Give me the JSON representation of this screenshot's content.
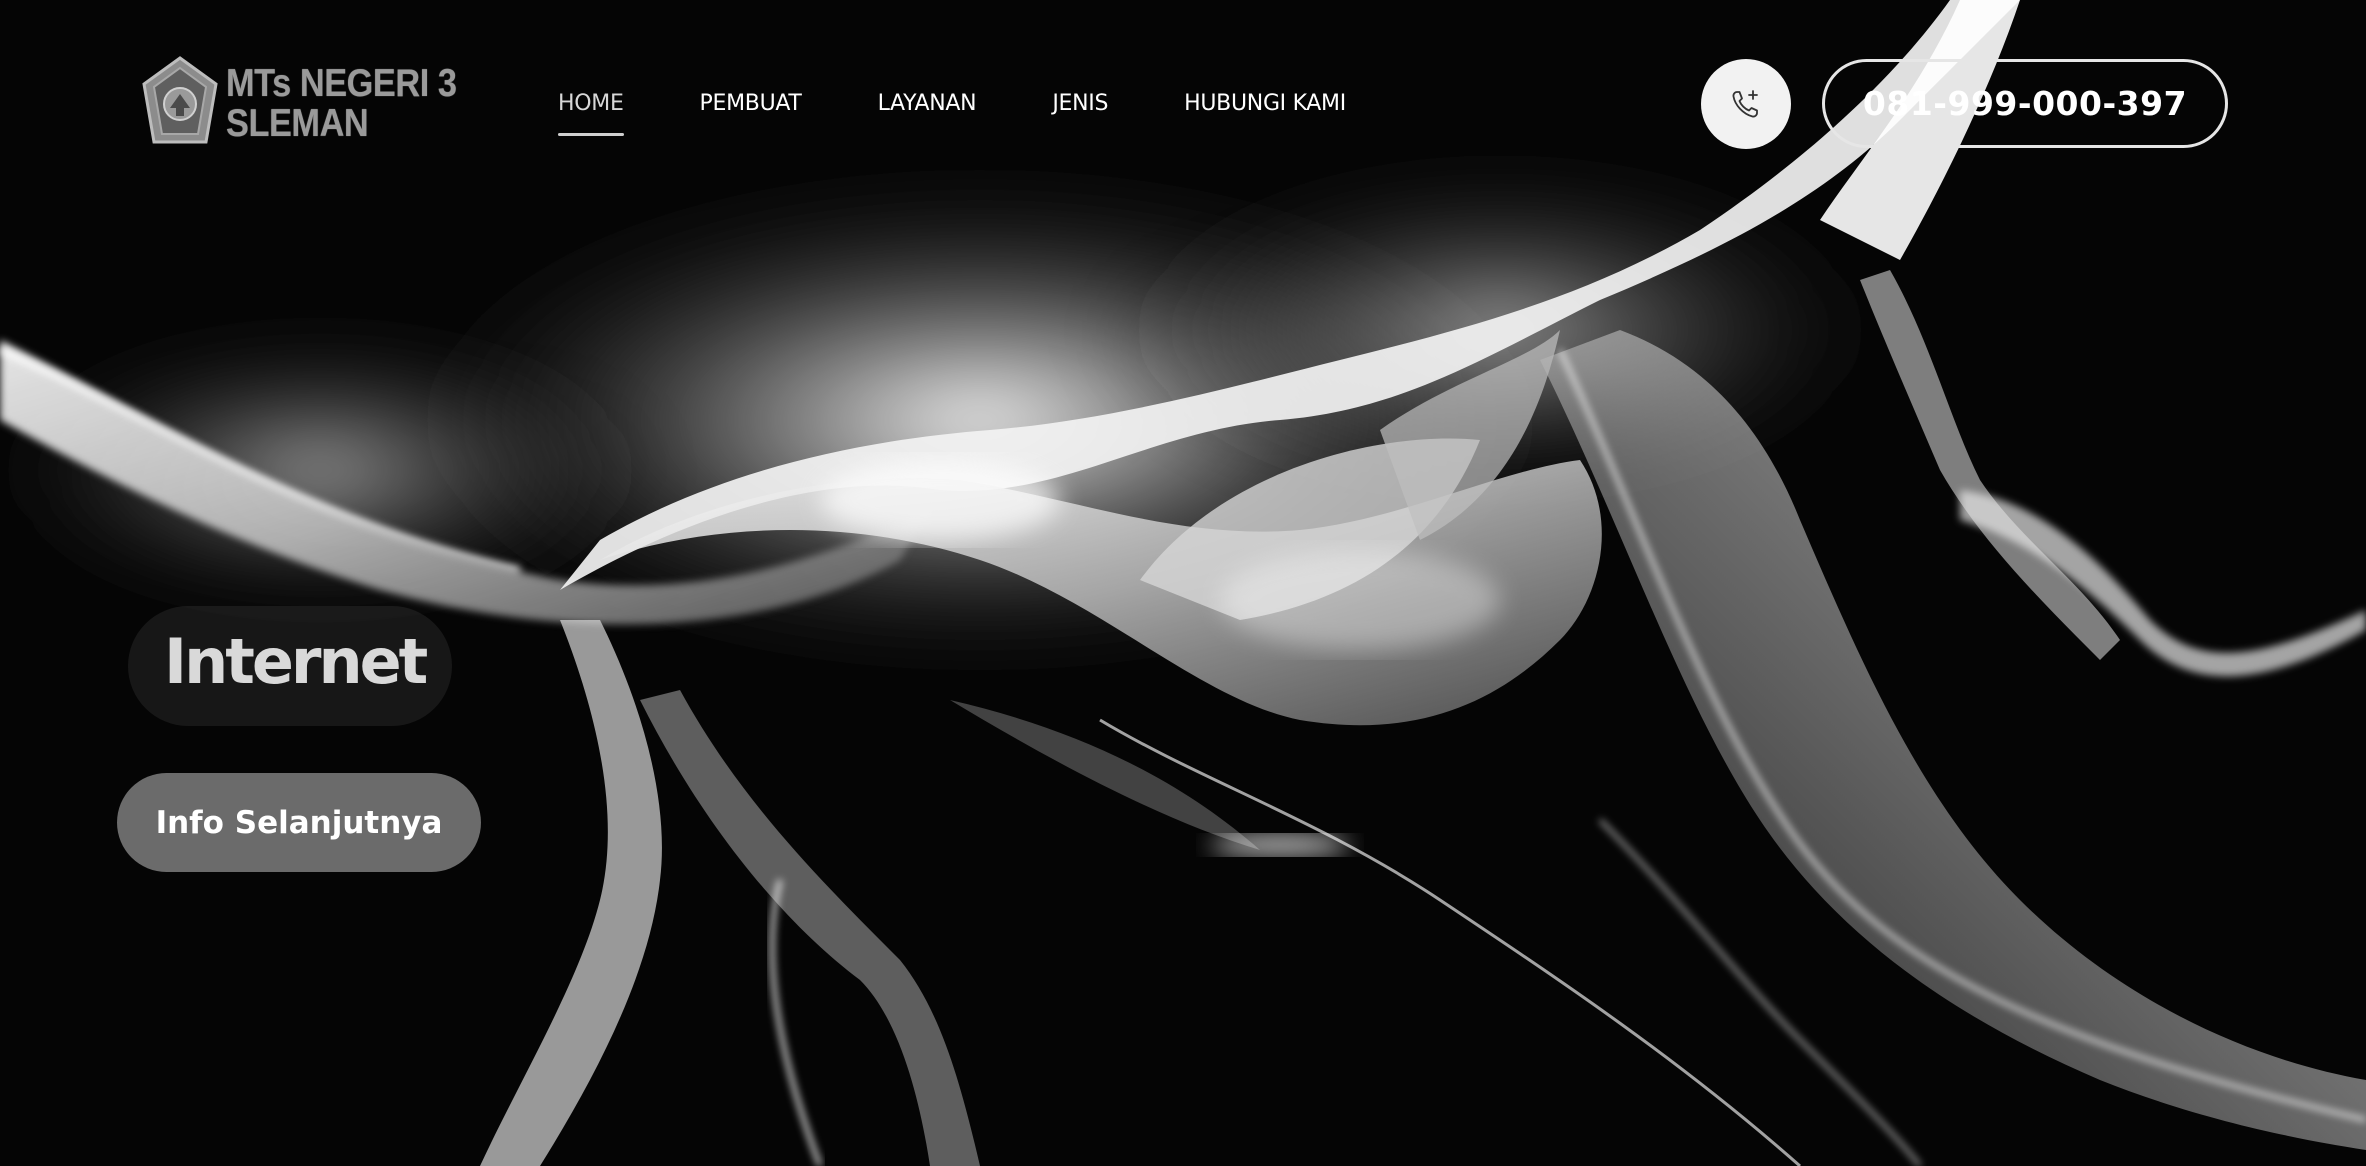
{
  "brand": {
    "line1": "MTs NEGERI 3",
    "line2": "SLEMAN",
    "emblem_icon": "school-shield-emblem-icon"
  },
  "nav": {
    "items": [
      {
        "label": "HOME",
        "active": true
      },
      {
        "label": "PEMBUAT",
        "active": false
      },
      {
        "label": "LAYANAN",
        "active": false
      },
      {
        "label": "JENIS",
        "active": false
      },
      {
        "label": "HUBUNGI KAMI",
        "active": false
      }
    ]
  },
  "contact": {
    "phone_icon": "phone-add-icon",
    "phone_number": "081-999-000-397"
  },
  "hero": {
    "title": "Internet",
    "cta_label": "Info Selanjutnya",
    "background": "abstract-white-light-waves-on-black"
  },
  "colors": {
    "background": "#000000",
    "text": "#ffffff",
    "button": "#6b6b6b",
    "phone_circle": "#f2f2f2"
  }
}
